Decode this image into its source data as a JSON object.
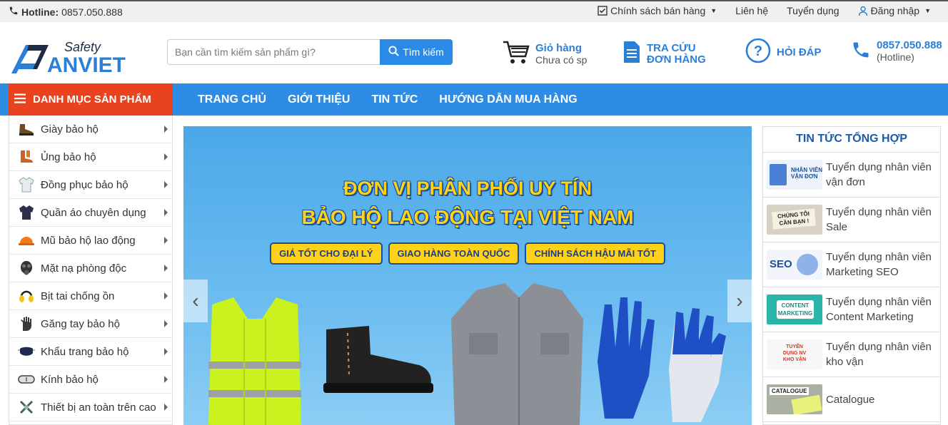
{
  "topbar": {
    "hotline_label": "Hotline:",
    "hotline_number": "0857.050.888",
    "links": [
      "Chính sách bán hàng",
      "Liên hệ",
      "Tuyển dụng",
      "Đăng nhập"
    ]
  },
  "header": {
    "logo_text": "ANVIET",
    "logo_tag": "Safety",
    "search_placeholder": "Bạn cần tìm kiếm sản phẩm gì?",
    "search_button": "Tìm kiếm",
    "cart_title": "Giỏ hàng",
    "cart_sub": "Chưa có sp",
    "order_line1": "TRA CỨU",
    "order_line2": "ĐƠN HÀNG",
    "faq": "HỎI ĐÁP",
    "phone": "0857.050.888",
    "phone_sub": "(Hotline)"
  },
  "nav": {
    "category_title": "DANH MỤC SẢN PHẨM",
    "menu": [
      "TRANG CHỦ",
      "GIỚI THIỆU",
      "TIN TỨC",
      "HƯỚNG DẪN MUA HÀNG"
    ]
  },
  "categories": [
    {
      "label": "Giày bảo hộ",
      "icon": "boot-icon"
    },
    {
      "label": "Ủng bảo hộ",
      "icon": "rubber-boot-icon"
    },
    {
      "label": "Đồng phục bảo hộ",
      "icon": "uniform-icon"
    },
    {
      "label": "Quần áo chuyên dụng",
      "icon": "jacket-icon"
    },
    {
      "label": "Mũ bảo hộ lao động",
      "icon": "helmet-icon"
    },
    {
      "label": "Mặt nạ phòng độc",
      "icon": "gas-mask-icon"
    },
    {
      "label": "Bịt tai chống ồn",
      "icon": "earmuff-icon"
    },
    {
      "label": "Găng tay bảo hộ",
      "icon": "glove-icon"
    },
    {
      "label": "Khẩu trang bảo hộ",
      "icon": "face-mask-icon"
    },
    {
      "label": "Kính bảo hộ",
      "icon": "goggles-icon"
    },
    {
      "label": "Thiết bị an toàn trên cao",
      "icon": "harness-icon"
    }
  ],
  "banner": {
    "line1": "ĐƠN VỊ PHÂN PHỐI UY TÍN",
    "line2": "BẢO HỘ LAO ĐỘNG TẠI VIỆT NAM",
    "badges": [
      "GIÁ TỐT CHO ĐẠI LÝ",
      "GIAO HÀNG TOÀN QUỐC",
      "CHÍNH SÁCH HẬU MÃI TỐT"
    ]
  },
  "news": {
    "title": "TIN TỨC TỔNG HỢP",
    "items": [
      {
        "title": "Tuyển dụng nhân viên vận đơn",
        "thumb_text": "NHÂN VIÊN VẬN ĐƠN"
      },
      {
        "title": "Tuyển dụng nhân viên Sale",
        "thumb_text": "CHÚNG TÔI CẦN BẠN !"
      },
      {
        "title": "Tuyển dụng nhân viên Marketing SEO",
        "thumb_text": "SEO"
      },
      {
        "title": "Tuyển dụng nhân viên Content Marketing",
        "thumb_text": "CONTENT MARKETING"
      },
      {
        "title": "Tuyển dụng nhân viên kho vận",
        "thumb_text": "TUYỂN DỤNG NV KHO VẬN"
      },
      {
        "title": "Catalogue",
        "thumb_text": "CATALOGUE"
      }
    ]
  },
  "colors": {
    "accent_blue": "#2f8ce4",
    "accent_red": "#e8431e",
    "banner_yellow": "#ffd21a"
  }
}
